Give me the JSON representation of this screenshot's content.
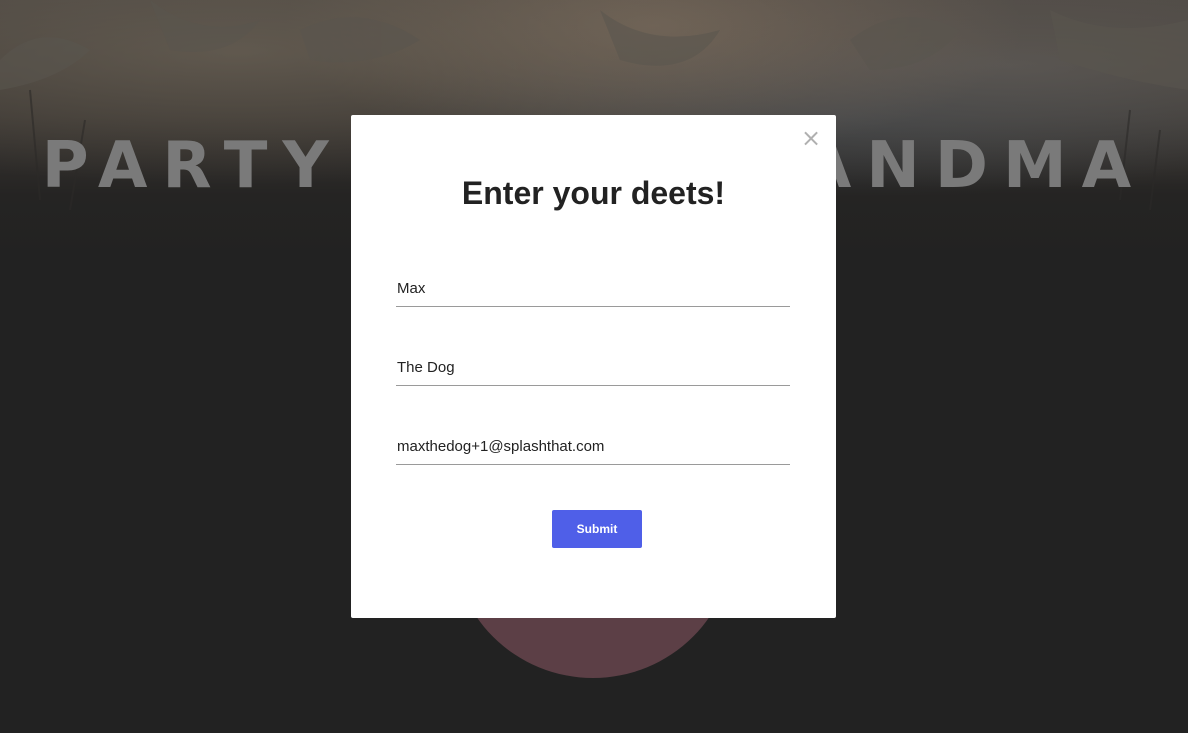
{
  "event": {
    "title": "PARTY WITH GRANDMA"
  },
  "modal": {
    "close_glyph": "×",
    "title": "Enter your deets!",
    "fields": {
      "first_name": {
        "value": "Max"
      },
      "last_name": {
        "value": "The Dog"
      },
      "email": {
        "value": "maxthedog+1@splashthat.com"
      }
    },
    "submit_label": "Submit"
  },
  "colors": {
    "accent": "#4f5fe8",
    "overlay": "#222222",
    "circle": "#5c3f46"
  },
  "icons": {
    "close": "close-icon"
  }
}
